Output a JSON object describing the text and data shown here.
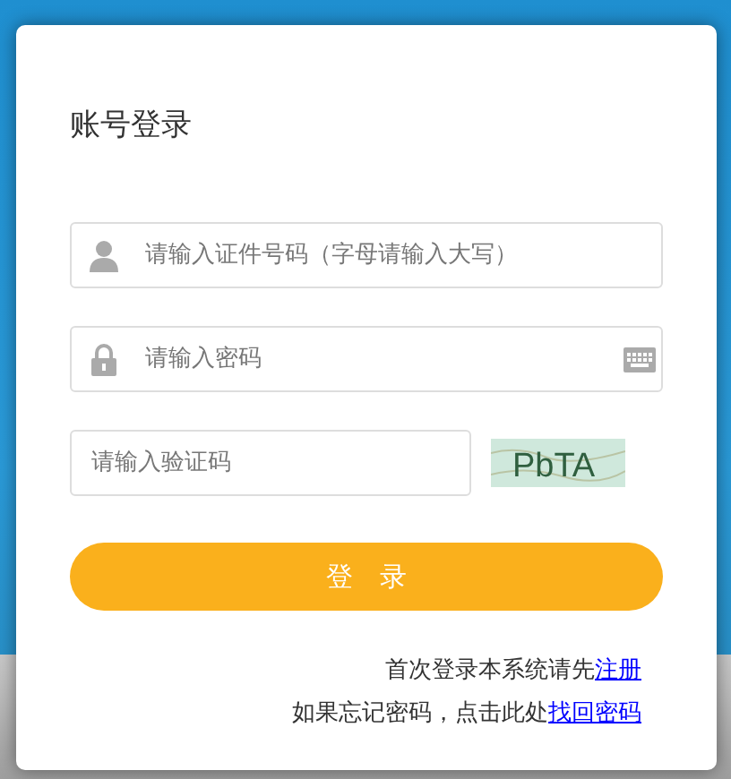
{
  "title": "账号登录",
  "fields": [
    {
      "kind": "user",
      "placeholder": "请输入证件号码（字母请输入大写）"
    },
    {
      "kind": "password",
      "placeholder": "请输入密码"
    }
  ],
  "captcha": {
    "placeholder": "请输入验证码",
    "image_text": "PbTA"
  },
  "login_button": "登　录",
  "links": [
    {
      "text": "首次登录本系统请先",
      "link": "注册"
    },
    {
      "text": "如果忘记密码，点击此处",
      "link": "找回密码"
    }
  ]
}
